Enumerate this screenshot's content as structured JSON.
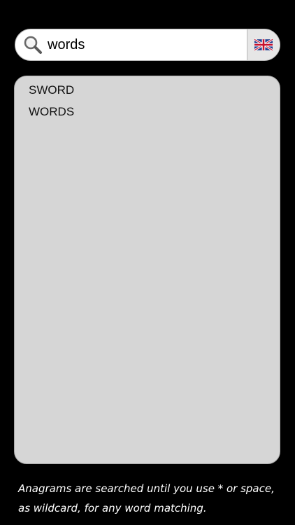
{
  "search": {
    "value": "words",
    "icon": "search-icon"
  },
  "language": {
    "icon": "uk-flag-icon"
  },
  "results": [
    {
      "word": "SWORD"
    },
    {
      "word": "WORDS"
    }
  ],
  "hint": {
    "text": "Anagrams are searched until you use * or space, as wildcard, for any word matching."
  },
  "colors": {
    "background": "#000000",
    "panel": "#d6d6d6",
    "search_bg": "#ffffff"
  }
}
